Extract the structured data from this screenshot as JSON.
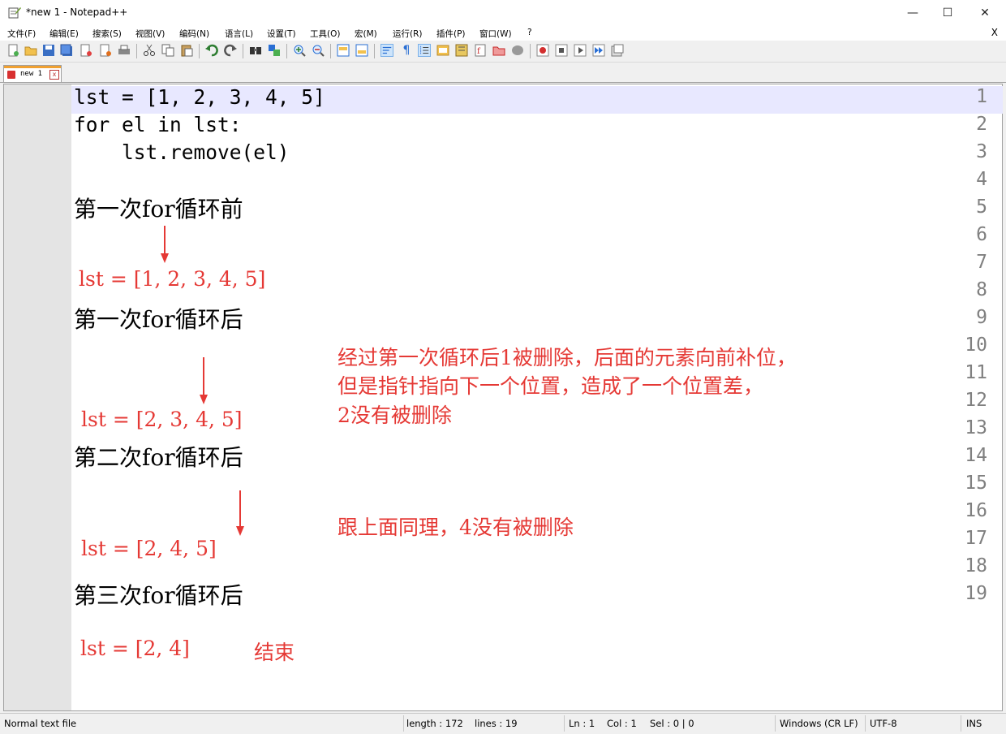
{
  "window": {
    "title": "*new 1 - Notepad++",
    "minimize": "—",
    "maximize": "☐",
    "close": "✕"
  },
  "menu": {
    "items": [
      "文件(F)",
      "编辑(E)",
      "搜索(S)",
      "视图(V)",
      "编码(N)",
      "语言(L)",
      "设置(T)",
      "工具(O)",
      "宏(M)",
      "运行(R)",
      "插件(P)",
      "窗口(W)",
      "?"
    ],
    "close": "X"
  },
  "tab": {
    "label": "new 1",
    "close": "x"
  },
  "editor": {
    "line_numbers": [
      "1",
      "2",
      "3",
      "4",
      "5",
      "6",
      "7",
      "8",
      "9",
      "10",
      "11",
      "12",
      "13",
      "14",
      "15",
      "16",
      "17",
      "18",
      "19"
    ],
    "code": {
      "line1": "lst = [1, 2, 3, 4, 5]",
      "line2": "for el in lst:",
      "line3": "    lst.remove(el)"
    },
    "headings": {
      "h1": "第一次for循环前",
      "h2": "第一次for循环后",
      "h3": "第二次for循环后",
      "h4": "第三次for循环后"
    },
    "annotations": {
      "list1": "lst = [1, 2, 3, 4, 5]",
      "list2": "lst = [2, 3, 4, 5]",
      "list3": "lst = [2, 4, 5]",
      "list4": "lst = [2, 4]",
      "end": "结束",
      "note1_line1": "经过第一次循环后1被删除，后面的元素向前补位，",
      "note1_line2": "但是指针指向下一个位置，造成了一个位置差，",
      "note1_line3": "2没有被删除",
      "note2": "跟上面同理，4没有被删除"
    },
    "colors": {
      "annotation": "#e53935",
      "current_line": "#e8e8ff"
    }
  },
  "status": {
    "file_type": "Normal text file",
    "length": "length : 172",
    "lines": "lines : 19",
    "ln": "Ln : 1",
    "col": "Col : 1",
    "sel": "Sel : 0 | 0",
    "eol": "Windows (CR LF)",
    "encoding": "UTF-8",
    "mode": "INS"
  }
}
